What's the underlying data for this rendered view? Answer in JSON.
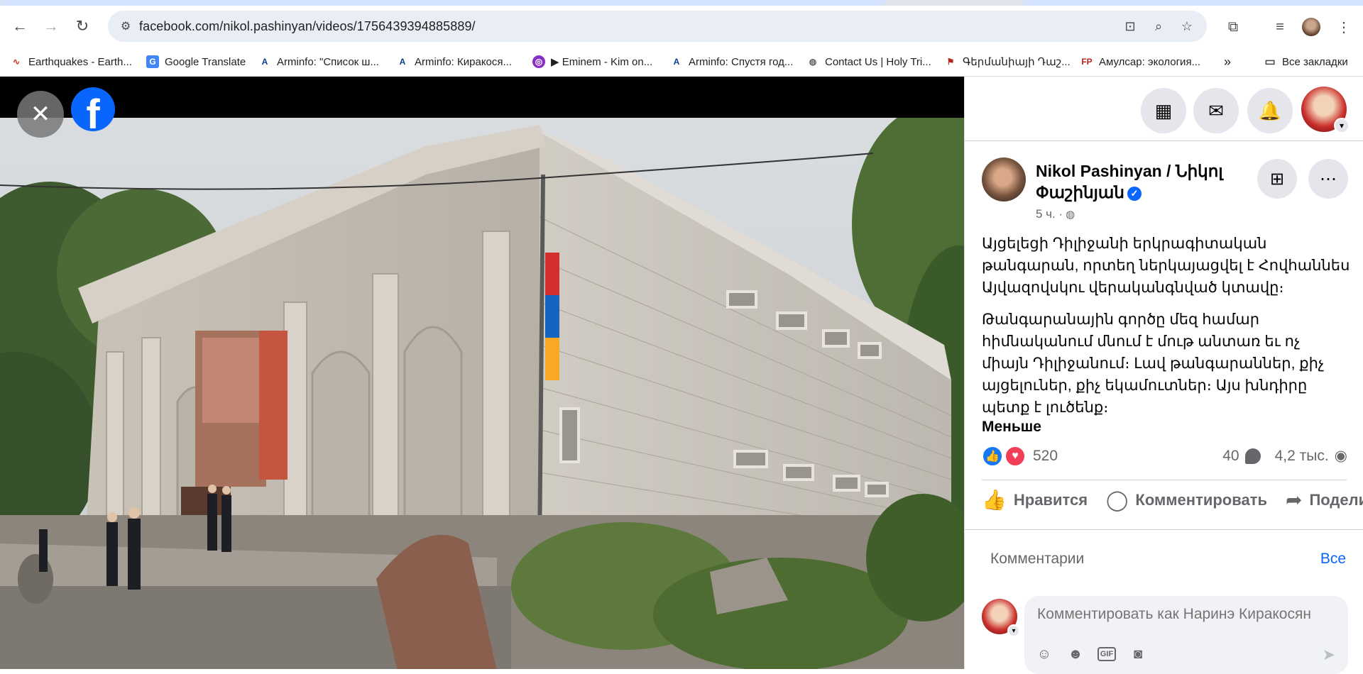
{
  "browser": {
    "url": "facebook.com/nikol.pashinyan/videos/1756439394885889/",
    "bookmarks": [
      {
        "label": "Earthquakes - Earth...",
        "icon": "seismo-icon"
      },
      {
        "label": "Google Translate",
        "icon": "translate-icon"
      },
      {
        "label": "Arminfo: \"Список ш...",
        "icon": "arminfo-icon"
      },
      {
        "label": "Arminfo: Киракося...",
        "icon": "arminfo-icon"
      },
      {
        "label": "▶ Eminem - Kim on...",
        "icon": "podcast-icon"
      },
      {
        "label": "Arminfo: Спустя год...",
        "icon": "arminfo-icon"
      },
      {
        "label": "Contact Us | Holy Tri...",
        "icon": "globe-icon"
      },
      {
        "label": "Գերմանիայի Դաշ...",
        "icon": "flag-icon"
      },
      {
        "label": "Амулсар: экология...",
        "icon": "fp-icon"
      }
    ],
    "all_bookmarks": "Все закладки",
    "more_bookmarks": "»"
  },
  "post": {
    "author": "Nikol Pashinyan / Նիկոլ Փաշինյան",
    "time": "5 ч. ·",
    "paragraphs": [
      "Այցելեցի Դիլիջանի երկրագիտական թանգարան, որտեղ ներկայացվել է Հովհաննես Այվազովսկու վերականգնված կտավը։",
      "Թանգարանային գործը մեզ համար հիմնականում մնում է մութ անտառ եւ ոչ միայն Դիլիջանում։ Լավ թանգարաններ, քիչ այցելուներ, քիչ եկամուտներ։ Այս խնդիրը պետք է լուծենք։"
    ],
    "see_less": "Меньше",
    "reaction_count": "520",
    "comment_count": "40",
    "view_count": "4,2 тыс.",
    "actions": {
      "like": "Нравится",
      "comment": "Комментировать",
      "share": "Поделиться"
    }
  },
  "comments": {
    "title": "Комментарии",
    "filter": "Все",
    "placeholder": "Комментировать как Наринэ Киракосян"
  },
  "colors": {
    "fb_blue": "#0866ff",
    "like_blue": "#1877f2",
    "love_red": "#f33e58"
  }
}
